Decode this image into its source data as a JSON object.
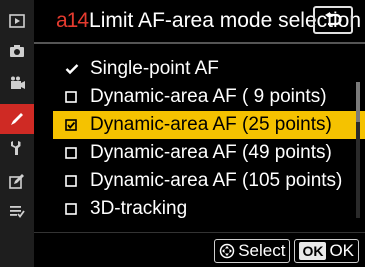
{
  "sidebar": {
    "tabs": [
      {
        "icon": "playback-icon",
        "active": false
      },
      {
        "icon": "photo-shooting-icon",
        "active": false
      },
      {
        "icon": "movie-shooting-icon",
        "active": false
      },
      {
        "icon": "custom-settings-pencil-icon",
        "active": true
      },
      {
        "icon": "setup-wrench-icon",
        "active": false
      },
      {
        "icon": "retouch-icon",
        "active": false
      },
      {
        "icon": "my-menu-icon",
        "active": false
      }
    ],
    "active_color": "#cf2a24"
  },
  "header": {
    "code": "a14",
    "title": "Limit AF-area mode selection",
    "code_color": "#e53b2f"
  },
  "list": {
    "items": [
      {
        "label": "Single-point AF",
        "state": "locked-check"
      },
      {
        "label": "Dynamic-area AF ( 9 points)",
        "state": "unchecked"
      },
      {
        "label": "Dynamic-area AF (25 points)",
        "state": "checked",
        "highlighted": true
      },
      {
        "label": "Dynamic-area AF (49 points)",
        "state": "unchecked"
      },
      {
        "label": "Dynamic-area AF (105 points)",
        "state": "unchecked"
      },
      {
        "label": "3D-tracking",
        "state": "unchecked"
      }
    ],
    "highlight_color": "#f5c200"
  },
  "footer": {
    "select_label": "Select",
    "ok_button_text": "OK",
    "ok_label": "OK"
  }
}
